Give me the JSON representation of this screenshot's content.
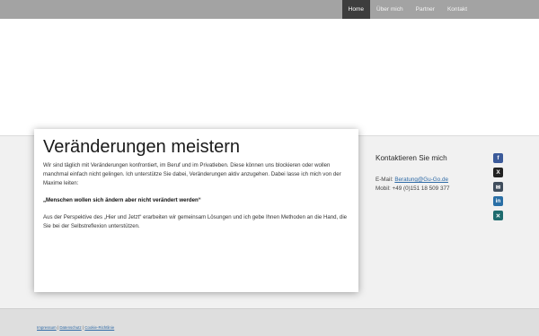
{
  "nav": {
    "items": [
      {
        "label": "Home",
        "active": true
      },
      {
        "label": "Über mich"
      },
      {
        "label": "Partner"
      },
      {
        "label": "Kontakt"
      }
    ]
  },
  "main": {
    "title": "Veränderungen meistern",
    "intro": "Wir sind täglich mit Veränderungen konfrontiert, im Beruf und im Privatleben. Diese können uns blockieren oder wollen manchmal einfach nicht gelingen. Ich unterstütze Sie dabei, Veränderungen aktiv anzugehen. Dabei lasse ich mich von der Maxime leiten:",
    "maxim": "„Menschen wollen sich ändern aber nicht verändert werden“",
    "body": "Aus der Perspektive des „Hier und Jetzt“ erarbeiten wir gemeinsam Lösungen und ich gebe Ihnen Methoden an die Hand, die Sie bei der Selbstreflexion unterstützen."
  },
  "contact": {
    "heading": "Kontaktieren Sie mich",
    "email_label": "E-Mail: ",
    "email": "Beratung@Gu-Go.de",
    "phone_label": "Mobil: ",
    "phone": "+49 (0)151 18 509 377"
  },
  "social": [
    {
      "icon": "facebook-icon",
      "glyph": "f",
      "color": "#3b5a9a"
    },
    {
      "icon": "x-icon",
      "glyph": "X",
      "color": "#222222"
    },
    {
      "icon": "mail-icon",
      "glyph": "✉",
      "color": "#3f4d5c"
    },
    {
      "icon": "linkedin-icon",
      "glyph": "in",
      "color": "#2a6fa6"
    },
    {
      "icon": "xing-icon",
      "glyph": "✕",
      "color": "#1e6b6e"
    }
  ],
  "footer": {
    "impressum": "Impressum",
    "datenschutz": "Datenschutz",
    "cookies": "Cookie-Richtlinie",
    "separator": " | "
  }
}
